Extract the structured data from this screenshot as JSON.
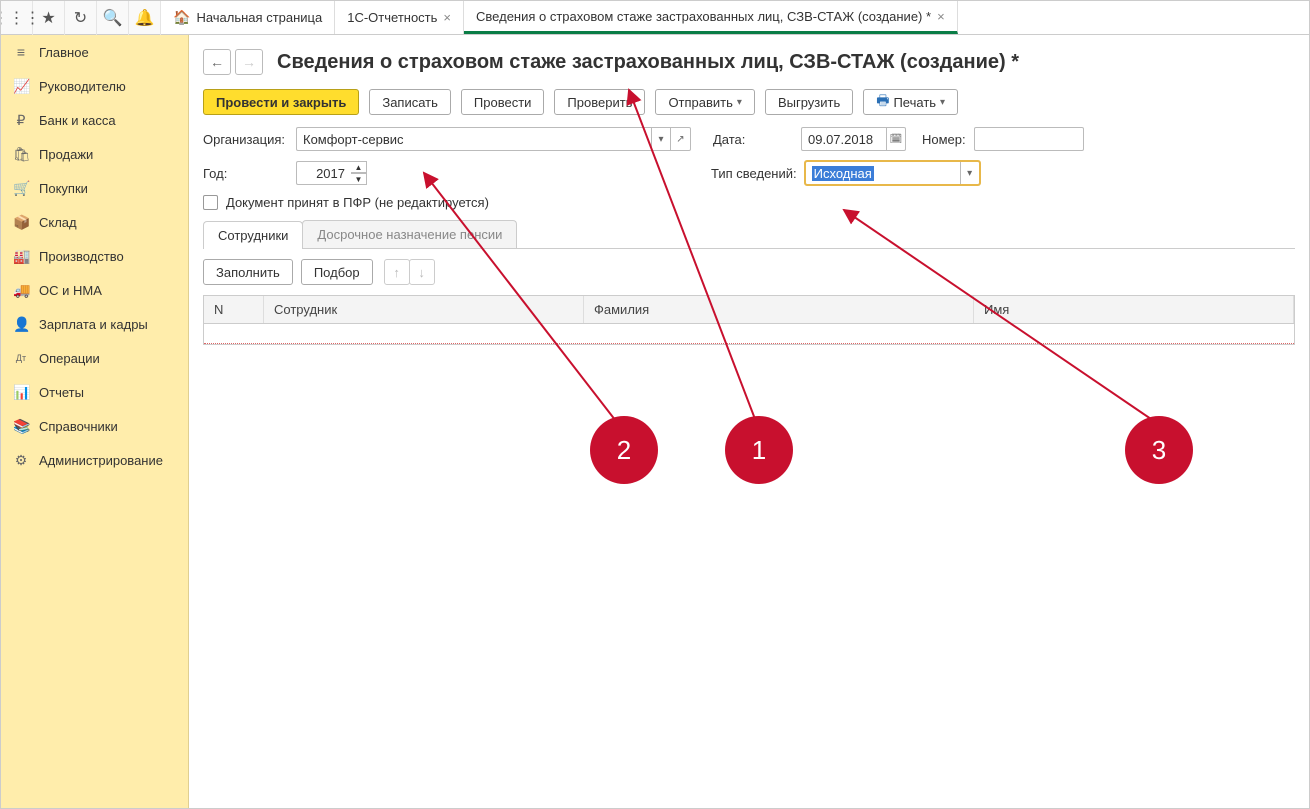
{
  "topIcons": [
    "apps",
    "star",
    "swap",
    "search",
    "bell"
  ],
  "tabs": [
    {
      "label": "Начальная страница",
      "home": true,
      "closable": false,
      "active": false
    },
    {
      "label": "1С-Отчетность",
      "home": false,
      "closable": true,
      "active": false
    },
    {
      "label": "Сведения о страховом стаже застрахованных лиц, СЗВ-СТАЖ (создание) *",
      "home": false,
      "closable": true,
      "active": true
    }
  ],
  "sidebar": [
    {
      "icon": "≡",
      "label": "Главное"
    },
    {
      "icon": "📈",
      "label": "Руководителю"
    },
    {
      "icon": "₽",
      "label": "Банк и касса"
    },
    {
      "icon": "🛍",
      "label": "Продажи"
    },
    {
      "icon": "🛒",
      "label": "Покупки"
    },
    {
      "icon": "📦",
      "label": "Склад"
    },
    {
      "icon": "🏭",
      "label": "Производство"
    },
    {
      "icon": "🚚",
      "label": "ОС и НМА"
    },
    {
      "icon": "👤",
      "label": "Зарплата и кадры"
    },
    {
      "icon": "Дт",
      "label": "Операции"
    },
    {
      "icon": "📊",
      "label": "Отчеты"
    },
    {
      "icon": "📚",
      "label": "Справочники"
    },
    {
      "icon": "⚙",
      "label": "Администрирование"
    }
  ],
  "page": {
    "title": "Сведения о страховом стаже застрахованных лиц, СЗВ-СТАЖ (создание) *",
    "toolbar": {
      "post_close": "Провести и закрыть",
      "write": "Записать",
      "post": "Провести",
      "check": "Проверить",
      "send": "Отправить",
      "export": "Выгрузить",
      "print": "Печать"
    },
    "form": {
      "org_label": "Организация:",
      "org_value": "Комфорт-сервис",
      "date_label": "Дата:",
      "date_value": "09.07.2018",
      "number_label": "Номер:",
      "number_value": "",
      "year_label": "Год:",
      "year_value": "2017",
      "type_label": "Тип сведений:",
      "type_value": "Исходная",
      "accepted_label": "Документ принят в ПФР (не редактируется)"
    },
    "formtabs": {
      "employees": "Сотрудники",
      "early": "Досрочное назначение пенсии"
    },
    "subtoolbar": {
      "fill": "Заполнить",
      "pick": "Подбор"
    },
    "grid": {
      "n": "N",
      "employee": "Сотрудник",
      "lastname": "Фамилия",
      "firstname": "Имя"
    }
  },
  "callouts": {
    "1": "1",
    "2": "2",
    "3": "3"
  }
}
